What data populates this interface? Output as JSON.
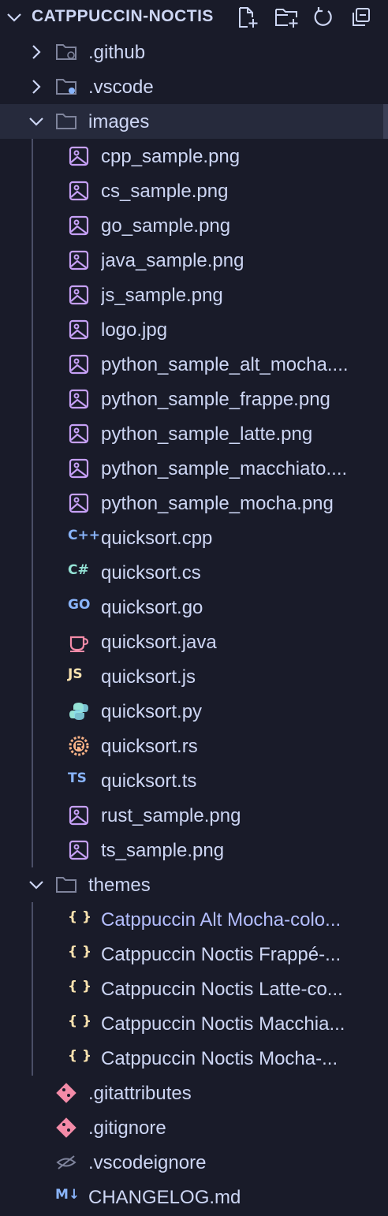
{
  "explorer": {
    "title": "CATPPUCCIN-NOCTIS",
    "actions": [
      {
        "name": "new-file-button",
        "icon": "new-file-icon"
      },
      {
        "name": "new-folder-button",
        "icon": "new-folder-icon"
      },
      {
        "name": "refresh-button",
        "icon": "refresh-icon"
      },
      {
        "name": "collapse-all-button",
        "icon": "collapse-all-icon"
      }
    ]
  },
  "tree": {
    "github": ".github",
    "vscode": ".vscode",
    "images": {
      "label": "images",
      "files": [
        "cpp_sample.png",
        "cs_sample.png",
        "go_sample.png",
        "java_sample.png",
        "js_sample.png",
        "logo.jpg",
        "python_sample_alt_mocha....",
        "python_sample_frappe.png",
        "python_sample_latte.png",
        "python_sample_macchiato....",
        "python_sample_mocha.png",
        "quicksort.cpp",
        "quicksort.cs",
        "quicksort.go",
        "quicksort.java",
        "quicksort.js",
        "quicksort.py",
        "quicksort.rs",
        "quicksort.ts",
        "rust_sample.png",
        "ts_sample.png"
      ]
    },
    "themes": {
      "label": "themes",
      "files": [
        "Catppuccin Alt Mocha-colo...",
        "Catppuccin Noctis Frappé-...",
        "Catppuccin Noctis Latte-co...",
        "Catppuccin Noctis Macchia...",
        "Catppuccin Noctis Mocha-..."
      ]
    },
    "root_files": [
      ".gitattributes",
      ".gitignore",
      ".vscodeignore",
      "CHANGELOG.md"
    ]
  },
  "icon_text": {
    "cpp": "C++",
    "cs": "C#",
    "go": "GO",
    "js": "JS",
    "ts": "TS",
    "json": "{ }",
    "md": "M↓"
  },
  "colors": {
    "background": "#191b29",
    "selected_row": "#262a3c",
    "text": "#cdd6f4",
    "accent_text": "#b4befe",
    "image_icon": "#c6a0f6",
    "json_icon": "#f9e2af",
    "git_icon": "#f38ba8"
  }
}
